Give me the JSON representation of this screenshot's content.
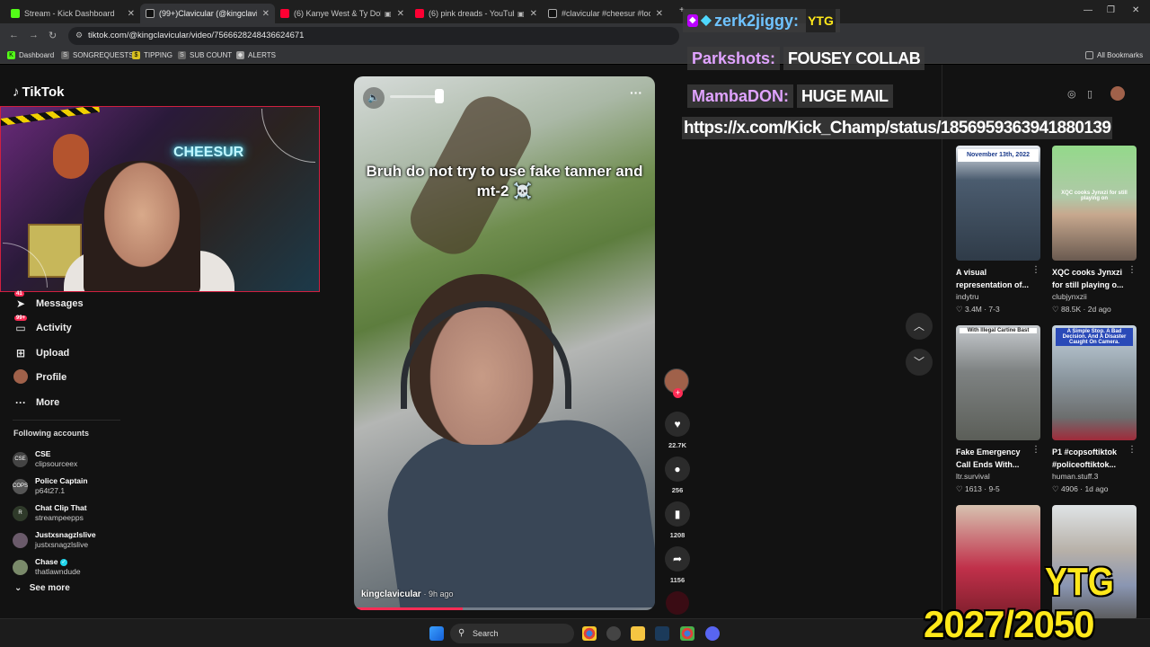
{
  "tabs": [
    {
      "title": "Stream - Kick Dashboard",
      "color": "#53fc18"
    },
    {
      "title": "(99+)Clavicular (@kingclavicular",
      "color": "#ffffff"
    },
    {
      "title": "(6) Kanye West & Ty Dolla $",
      "color": "#ff0033"
    },
    {
      "title": "(6) pink dreads - YouTube",
      "color": "#ff0033"
    },
    {
      "title": "#clavicular #cheesur #lookma",
      "color": "#ffffff"
    }
  ],
  "address": {
    "url": "tiktok.com/@kingclavicular/video/7566628248436624671"
  },
  "bookmarks": [
    "Dashboard",
    "SONGREQUESTS",
    "TIPPING",
    "SUB COUNT",
    "ALERTS"
  ],
  "all_bookmarks": "All Bookmarks",
  "tiktok": {
    "logo": "TikTok",
    "webcam_sign": "CHEESUR",
    "nav": [
      {
        "label": "Messages",
        "badge": "41",
        "icon": "send-icon"
      },
      {
        "label": "Activity",
        "badge": "99+",
        "icon": "inbox-icon"
      },
      {
        "label": "Upload",
        "badge": "",
        "icon": "plus-square-icon"
      },
      {
        "label": "Profile",
        "badge": "",
        "icon": "avatar-icon"
      },
      {
        "label": "More",
        "badge": "",
        "icon": "ellipsis-icon"
      }
    ],
    "following_heading": "Following accounts",
    "following": [
      {
        "name": "CSE",
        "handle": "clipsourceex",
        "color": "#444444",
        "verified": false
      },
      {
        "name": "Police Captain",
        "handle": "p64t27.1",
        "color": "#555555",
        "verified": false
      },
      {
        "name": "Chat Clip That",
        "handle": "streampeepps",
        "color": "#2f3a2a",
        "verified": false
      },
      {
        "name": "Justxsnagzlslive",
        "handle": "justxsnagzlslive",
        "color": "#6a5a6a",
        "verified": false
      },
      {
        "name": "Chase",
        "handle": "thatlawndude",
        "color": "#7a8a6a",
        "verified": true
      }
    ],
    "see_more": "See more"
  },
  "video": {
    "caption": "Bruh do not try to use fake tanner and mt-2 ☠️",
    "author": "kingclavicular",
    "age": "· 9h ago",
    "progress": 0.36,
    "likes": "22.7K",
    "comments": "256",
    "saves": "1208",
    "shares": "1156"
  },
  "grid": [
    {
      "title": "A visual representation of...",
      "author": "indytru",
      "meta": "♡ 3.4M · 7-3",
      "thumb_text": "November 13th, 2022",
      "bg": "#4a5a6a"
    },
    {
      "title": "XQC cooks Jynxzi for still playing o...",
      "author": "clubjynxzii",
      "meta": "♡ 88.5K · 2d ago",
      "thumb_text": "XQC cooks Jynxzi for still playing on",
      "bg": "#8fcf8a"
    },
    {
      "title": "Fake Emergency Call Ends With...",
      "author": "ltr.survival",
      "meta": "♡ 1613 · 9-5",
      "thumb_text": "With Illegal Cartine Bast",
      "bg": "#6a6e6a"
    },
    {
      "title": "P1 #copsoftiktok #policeoftiktok...",
      "author": "human.stuff.3",
      "meta": "♡ 4906 · 1d ago",
      "thumb_text": "A Simple Stop. A Bad Decision. And A Disaster Caught On Camera.",
      "bg": "#7a8a96"
    },
    {
      "title": "",
      "author": "",
      "meta": "",
      "thumb_text": "",
      "bg": "#c0304a"
    },
    {
      "title": "",
      "author": "",
      "meta": "",
      "thumb_text": "",
      "bg": "#8a96b2"
    }
  ],
  "chat": [
    {
      "user": "zerk2jiggy:",
      "msg": "",
      "badge": "YTG",
      "color": "#6fc3ff"
    },
    {
      "user": "Parkshots:",
      "msg": "FOUSEY COLLAB",
      "badge": "",
      "color": "#e0a3ff"
    },
    {
      "user": "MambaDON:",
      "msg": "HUGE MAIL",
      "badge": "",
      "color": "#e0a3ff"
    }
  ],
  "chat_link": "https://x.com/Kick_Champ/status/1856959363941880139",
  "overlay": {
    "ytg": "YTG",
    "counter": "2027/2050"
  },
  "taskbar": {
    "search": "Search"
  }
}
